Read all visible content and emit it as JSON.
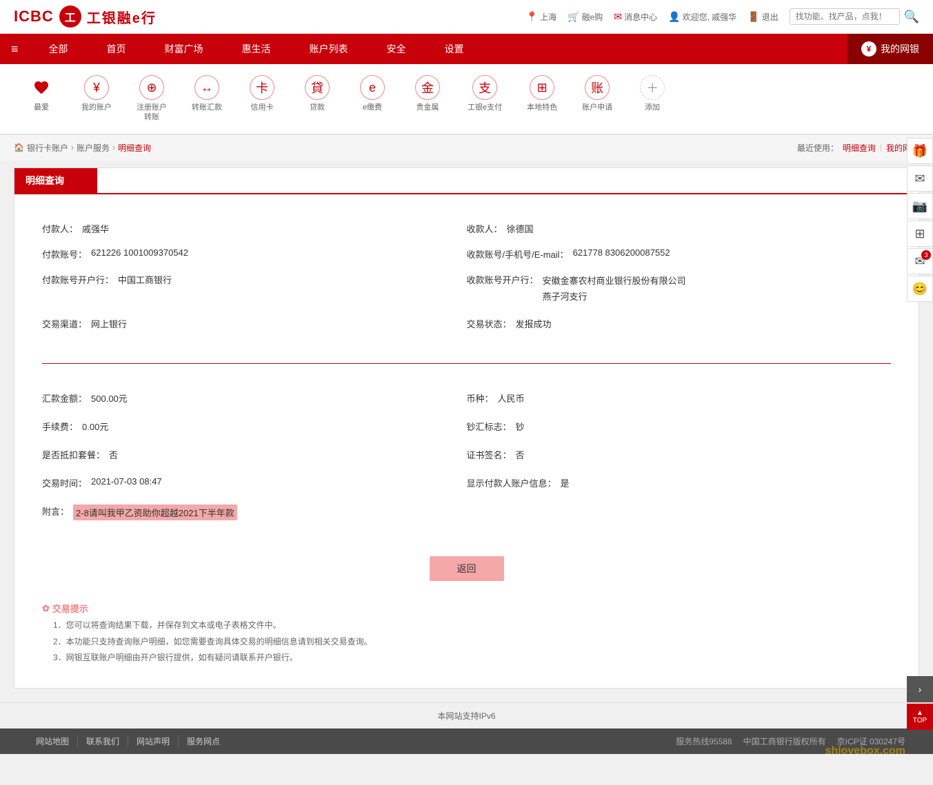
{
  "header": {
    "logo_icbc": "ICBC",
    "logo_circle_text": "工",
    "logo_name": "工银融e行",
    "location_icon": "📍",
    "location": "上海",
    "cart_icon": "🛒",
    "cart_label": "融e购",
    "msg_icon": "✉",
    "msg_label": "消息中心",
    "user_icon": "👤",
    "user_label": "欢迎您, 戚强华",
    "exit_icon": "🚪",
    "exit_label": "退出",
    "search_placeholder": "找功能、找产品，点我！",
    "search_icon": "🔍"
  },
  "nav": {
    "menu_icon": "≡",
    "items": [
      {
        "label": "全部",
        "active": false
      },
      {
        "label": "首页",
        "active": false
      },
      {
        "label": "财富广场",
        "active": false
      },
      {
        "label": "惠生活",
        "active": false
      },
      {
        "label": "账户列表",
        "active": false
      },
      {
        "label": "安全",
        "active": false
      },
      {
        "label": "设置",
        "active": false
      }
    ],
    "mybank_label": "我的网银"
  },
  "quick_bar": {
    "fav_label": "最爱",
    "items": [
      {
        "icon": "¥",
        "label": "我的账户"
      },
      {
        "icon": "⊕",
        "label": "注册账户\n转账"
      },
      {
        "icon": "↔",
        "label": "转账汇款"
      },
      {
        "icon": "卡",
        "label": "信用卡"
      },
      {
        "icon": "貸",
        "label": "贷款"
      },
      {
        "icon": "e",
        "label": "e缴费"
      },
      {
        "icon": "金",
        "label": "贵金属"
      },
      {
        "icon": "支",
        "label": "工银e支付"
      },
      {
        "icon": "⊞",
        "label": "本地特色"
      },
      {
        "icon": "账",
        "label": "账户申请"
      },
      {
        "icon": "+",
        "label": "添加"
      }
    ]
  },
  "breadcrumb": {
    "home_icon": "🏠",
    "items": [
      "银行卡账户",
      "账户服务",
      "明细查询"
    ],
    "recent_label": "最近使用：",
    "recent_links": [
      "明细查询",
      "我的网银"
    ]
  },
  "page": {
    "title": "明细查询",
    "payer_label": "付款人：",
    "payer_value": "戚强华",
    "payee_label": "收款人：",
    "payee_value": "徐德国",
    "payer_account_label": "付款账号：",
    "payer_account_value": "621226 1001009370542",
    "payee_account_label": "收款账号/手机号/E-mail：",
    "payee_account_value": "621778 8306200087552",
    "payer_bank_label": "付款账号开户行：",
    "payer_bank_value": "中国工商银行",
    "payee_bank_label": "收款账号开户行：",
    "payee_bank_value_line1": "安徽金寨农村商业银行股份有限公司",
    "payee_bank_value_line2": "燕子河支行",
    "channel_label": "交易渠道：",
    "channel_value": "网上银行",
    "status_label": "交易状态：",
    "status_value": "发报成功",
    "amount_label": "汇款金额：",
    "amount_value": "500.00元",
    "currency_label": "币种：",
    "currency_value": "人民币",
    "fee_label": "手续费：",
    "fee_value": "0.00元",
    "note_label": "钞汇标志：",
    "note_value": "钞",
    "deduct_label": "是否抵扣套餐：",
    "deduct_value": "否",
    "cert_label": "证书签名：",
    "cert_value": "否",
    "time_label": "交易时间：",
    "time_value": "2021-07-03 08:47",
    "show_payer_label": "显示付款人账户信息：",
    "show_payer_value": "是",
    "remark_label": "附言：",
    "remark_value": "2-8请叫我甲乙资助你超越2021下半年款",
    "return_btn": "返回",
    "tips_title": "交易提示",
    "tips": [
      "1．您可以将查询结果下载，并保存到文本或电子表格文件中。",
      "2．本功能只支持查询账户明细，如您需要查询具体交易的明细信息请到相关交易查询。",
      "3．网银互联账户明细由开户银行提供，如有疑问请联系开户银行。"
    ]
  },
  "footer": {
    "ipv6_text": "本网站支持IPv6",
    "nav_links": [
      "网站地图",
      "联系我们",
      "网站声明",
      "服务网点"
    ],
    "hotline": "服务热线95588",
    "copyright": "中国工商银行版权所有",
    "icp": "京ICP证 030247号"
  },
  "watermark": "shlovebox.com",
  "top_label": "TOP"
}
